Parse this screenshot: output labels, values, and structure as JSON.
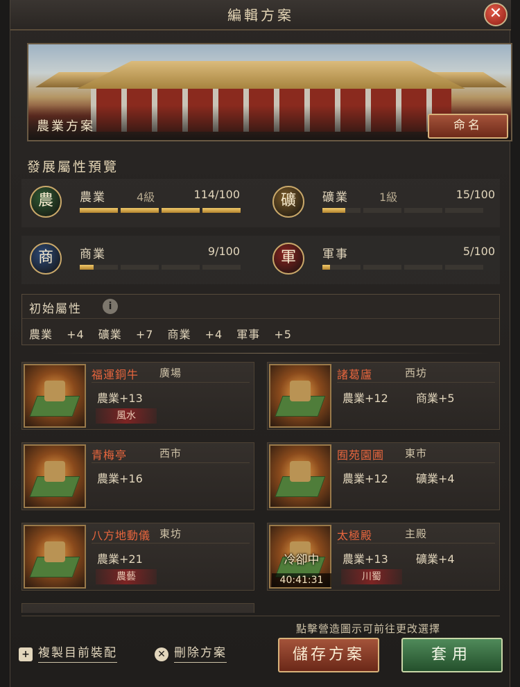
{
  "window": {
    "title": "編輯方案",
    "close_symbol": "✕"
  },
  "banner": {
    "plan_name": "農業方案",
    "rename_label": "命名"
  },
  "preview": {
    "title": "發展屬性預覽",
    "attributes": [
      {
        "icon_char": "農",
        "icon_color": "#2f5a33",
        "name": "農業",
        "level": "4級",
        "value": "114/100",
        "progress": [
          1,
          1,
          1,
          1
        ]
      },
      {
        "icon_char": "礦",
        "icon_color": "#7a5a28",
        "name": "礦業",
        "level": "1級",
        "value": "15/100",
        "progress": [
          0.6,
          0,
          0,
          0
        ]
      },
      {
        "icon_char": "商",
        "icon_color": "#2d4a78",
        "name": "商業",
        "level": "",
        "value": "9/100",
        "progress": [
          0.36,
          0,
          0,
          0
        ]
      },
      {
        "icon_char": "軍",
        "icon_color": "#8a2420",
        "name": "軍事",
        "level": "",
        "value": "5/100",
        "progress": [
          0.2,
          0,
          0,
          0
        ]
      }
    ]
  },
  "initial": {
    "title": "初始屬性",
    "info_symbol": "i",
    "stats": "農業 +4 礦業 +7 商業 +4 軍事 +5"
  },
  "buildings": [
    {
      "name": "福運銅牛",
      "location": "廣場",
      "bonuses": [
        "農業+13",
        ""
      ],
      "tag": "風水",
      "cooldown": "",
      "timer": ""
    },
    {
      "name": "諸葛廬",
      "location": "西坊",
      "bonuses": [
        "農業+12",
        "商業+5"
      ],
      "tag": "",
      "cooldown": "",
      "timer": ""
    },
    {
      "name": "青梅亭",
      "location": "西市",
      "bonuses": [
        "農業+16",
        ""
      ],
      "tag": "",
      "cooldown": "",
      "timer": ""
    },
    {
      "name": "囿苑園圃",
      "location": "東市",
      "bonuses": [
        "農業+12",
        "礦業+4"
      ],
      "tag": "",
      "cooldown": "",
      "timer": ""
    },
    {
      "name": "八方地動儀",
      "location": "東坊",
      "bonuses": [
        "農業+21",
        ""
      ],
      "tag": "農藝",
      "cooldown": "",
      "timer": ""
    },
    {
      "name": "太極殿",
      "location": "主殿",
      "bonuses": [
        "農業+13",
        "礦業+4"
      ],
      "tag": "川蜀",
      "cooldown": "冷卻中",
      "timer": "40:41:31"
    }
  ],
  "footer": {
    "hint": "點擊營造圖示可前往更改選擇",
    "copy_label": "複製目前裝配",
    "copy_icon": "+",
    "delete_label": "刪除方案",
    "delete_icon": "✕",
    "save_label": "儲存方案",
    "apply_label": "套用"
  }
}
